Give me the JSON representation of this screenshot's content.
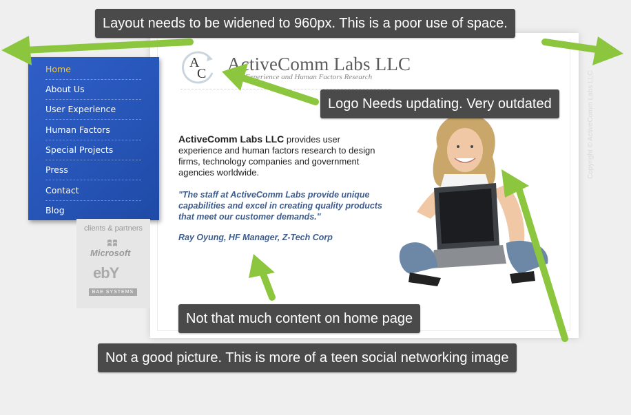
{
  "site": {
    "name": "ActiveComm Labs LLC",
    "tagline": "Experience and Human Factors Research",
    "logo_initials_top": "A",
    "logo_initials_bottom": "C",
    "copyright_vertical": "Copyright © ActiveComm Labs LLC"
  },
  "nav": {
    "items": [
      {
        "label": "Home",
        "active": true
      },
      {
        "label": "About Us"
      },
      {
        "label": "User Experience"
      },
      {
        "label": "Human Factors"
      },
      {
        "label": "Special Projects"
      },
      {
        "label": "Press"
      },
      {
        "label": "Contact"
      },
      {
        "label": "Blog"
      }
    ],
    "active_color": "#f4c945",
    "background_color": "#2857bb"
  },
  "clients": {
    "label": "clients & partners",
    "logos": [
      "Microsoft",
      "ebY",
      "BAE SYSTEMS"
    ]
  },
  "intro": {
    "company": "ActiveComm Labs LLC",
    "text": "provides user experience and human factors research to design firms, technology companies and government agencies worldwide."
  },
  "testimonial": {
    "quote": "\"The staff at ActiveComm Labs provide unique capabilities and excel in creating quality products that meet our customer demands.\"",
    "attribution": "Ray Oyung, HF Manager, Z-Tech Corp",
    "color": "#3e5c8c"
  },
  "photo": {
    "icon": "person-with-laptop-photo"
  },
  "annotations": {
    "layout": "Layout needs to be widened to 960px.  This is a poor use of space.",
    "logo": "Logo Needs updating.  Very outdated",
    "content": "Not that much content on home page",
    "picture": "Not a good picture.  This is more of a teen social networking image",
    "arrow_color": "#8cc63f",
    "note_bg": "#4a4a4a"
  }
}
